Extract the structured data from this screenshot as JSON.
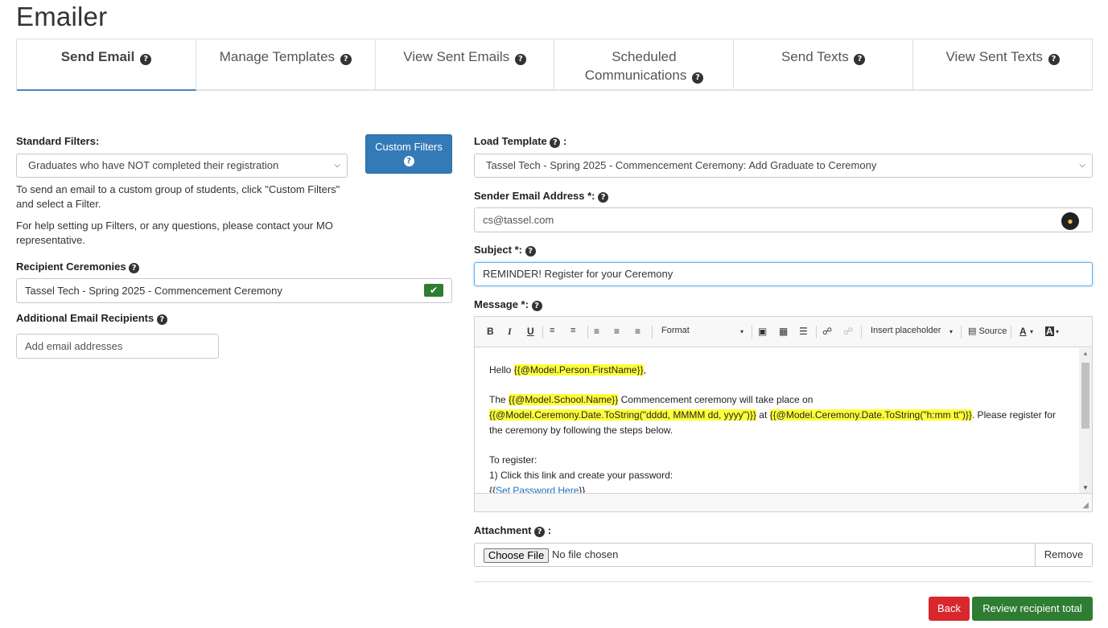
{
  "page": {
    "title": "Emailer"
  },
  "tabs": [
    {
      "label": "Send Email"
    },
    {
      "label": "Manage Templates"
    },
    {
      "label": "View Sent Emails"
    },
    {
      "label_line1": "Scheduled",
      "label_line2": "Communications"
    },
    {
      "label": "Send Texts"
    },
    {
      "label": "View Sent Texts"
    }
  ],
  "left": {
    "standard_filters_label": "Standard Filters:",
    "standard_filters_value": "Graduates who have NOT completed their registration",
    "custom_filters_button": "Custom Filters",
    "help_text_1": "To send an email to a custom group of students, click \"Custom Filters\" and select a Filter.",
    "help_text_2": "For help setting up Filters, or any questions, please contact your MO representative.",
    "recipient_ceremonies_label": "Recipient Ceremonies",
    "recipient_ceremonies_value": "Tassel Tech - Spring 2025 - Commencement Ceremony",
    "additional_recipients_label": "Additional Email Recipients",
    "additional_recipients_placeholder": "Add email addresses"
  },
  "right": {
    "load_template_label": "Load Template",
    "load_template_value": "Tassel Tech - Spring 2025 - Commencement Ceremony: Add Graduate to Ceremony",
    "sender_label": "Sender Email Address *:",
    "sender_value": "cs@tassel.com",
    "subject_label": "Subject *:",
    "subject_value": "REMINDER! Register for your Ceremony",
    "message_label": "Message *:",
    "attachment_label": "Attachment",
    "choose_file": "Choose File",
    "no_file": "No file chosen",
    "remove": "Remove"
  },
  "toolbar": {
    "format": "Format",
    "insert_placeholder": "Insert placeholder",
    "source": "Source"
  },
  "message": {
    "hello": "Hello ",
    "ph_firstname": "{{@Model.Person.FirstName}}",
    "comma": ",",
    "the": "The ",
    "ph_school": "{{@Model.School.Name}}",
    "ceremony_text": " Commencement ceremony will take place on",
    "ph_date": "{{@Model.Ceremony.Date.ToString(\"dddd, MMMM dd, yyyy\")}}",
    "at": " at ",
    "ph_time": "{{@Model.Ceremony.Date.ToString(\"h:mm tt\")}}",
    "register_text": ".  Please register for the ceremony by following the steps below.",
    "to_register": "To register:",
    "step1": "1) Click this link and create your password:",
    "link_open": "{{",
    "link_text": "Set Password Here",
    "link_close": "}}"
  },
  "actions": {
    "back": "Back",
    "review": "Review recipient total"
  },
  "colors": {
    "primary": "#337ab7",
    "danger": "#d9272e",
    "success": "#2e7d32",
    "highlight": "#ffff3a"
  }
}
